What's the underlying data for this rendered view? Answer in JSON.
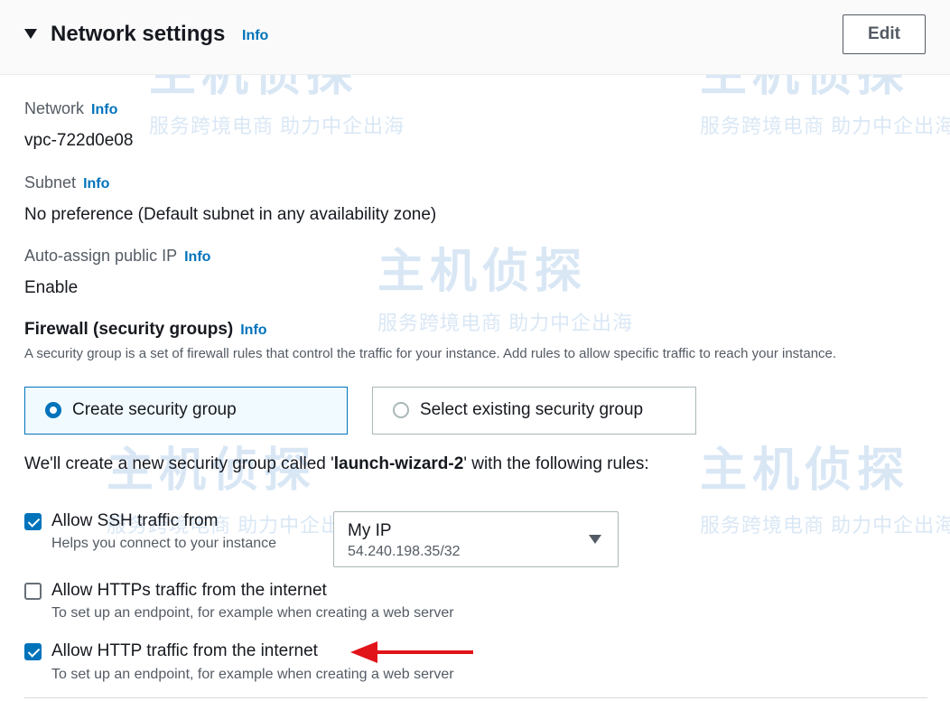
{
  "section": {
    "title": "Network settings",
    "info": "Info",
    "edit_label": "Edit"
  },
  "fields": {
    "network_label": "Network",
    "network_value": "vpc-722d0e08",
    "subnet_label": "Subnet",
    "subnet_value": "No preference (Default subnet in any availability zone)",
    "public_ip_label": "Auto-assign public IP",
    "public_ip_value": "Enable"
  },
  "firewall": {
    "title": "Firewall (security groups)",
    "description": "A security group is a set of firewall rules that control the traffic for your instance. Add rules to allow specific traffic to reach your instance.",
    "options": [
      {
        "label": "Create security group",
        "selected": true
      },
      {
        "label": "Select existing security group",
        "selected": false
      }
    ],
    "intro_prefix": "We'll create a new security group called '",
    "group_name": "launch-wizard-2",
    "intro_suffix": "' with the following rules:"
  },
  "rules": [
    {
      "label": "Allow SSH traffic from",
      "desc": "Helps you connect to your instance",
      "checked": true
    },
    {
      "label": "Allow HTTPs traffic from the internet",
      "desc": "To set up an endpoint, for example when creating a web server",
      "checked": false
    },
    {
      "label": "Allow HTTP traffic from the internet",
      "desc": "To set up an endpoint, for example when creating a web server",
      "checked": true
    }
  ],
  "ssh_source": {
    "value": "My IP",
    "detail": "54.240.198.35/32"
  },
  "watermark": {
    "main": "主机侦探",
    "sub": "服务跨境电商 助力中企出海"
  },
  "colors": {
    "accent": "#0073bb",
    "annotation_arrow": "#e1141a"
  }
}
